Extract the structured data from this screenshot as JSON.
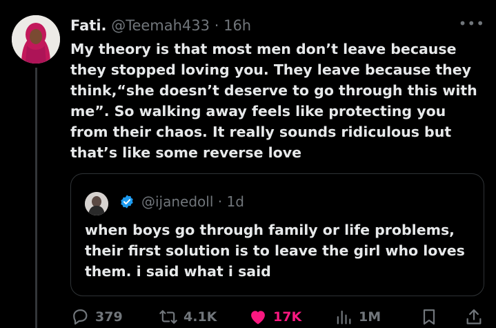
{
  "tweet": {
    "display_name": "Fati.",
    "handle": "@Teemah433",
    "separator": "·",
    "time": "16h",
    "more": "•••",
    "text": "My theory is that most men don’t leave because they stopped loving you. They leave because they think,“she doesn’t deserve to go through this with me”. So walking away feels like protecting you from their chaos. It really sounds ridiculous but that’s like some reverse love"
  },
  "quote": {
    "handle": "@ijanedoll",
    "separator": "·",
    "time": "1d",
    "verified": true,
    "text": "when boys go through family or life problems, their first solution is to leave the girl who loves them. i said what i said"
  },
  "actions": {
    "replies": "379",
    "reposts": "4.1K",
    "likes": "17K",
    "views": "1M"
  },
  "colors": {
    "background": "#000000",
    "text": "#e7e9ea",
    "muted": "#71767b",
    "like": "#f91880",
    "verified": "#1d9bf0"
  },
  "icons": [
    "reply-icon",
    "repost-icon",
    "heart-icon",
    "views-icon",
    "bookmark-icon",
    "share-icon",
    "verified-badge-icon"
  ]
}
